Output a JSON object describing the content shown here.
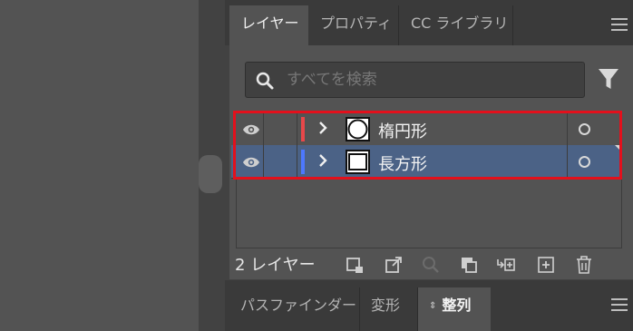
{
  "panel_tabs": [
    {
      "label": "レイヤー",
      "active": true
    },
    {
      "label": "プロパティ",
      "active": false
    },
    {
      "label": "CC ライブラリ",
      "active": false
    }
  ],
  "search": {
    "placeholder": "すべてを検索",
    "value": ""
  },
  "layers": [
    {
      "name": "楕円形",
      "color": "#e8484a",
      "thumbnail": "ellipse",
      "selected": false
    },
    {
      "name": "長方形",
      "color": "#4d78ff",
      "thumbnail": "rectangle",
      "selected": true
    }
  ],
  "footer": {
    "layer_count": "2 レイヤー",
    "icons": [
      "collect-for-export-icon",
      "export-icon",
      "locate-object-icon",
      "clipping-mask-icon",
      "new-sublayer-icon",
      "new-layer-icon",
      "trash-icon"
    ]
  },
  "bottom_tabs": [
    {
      "label": "パスファインダー",
      "active": false
    },
    {
      "label": "変形",
      "active": false
    },
    {
      "label": "整列",
      "active": true,
      "updown": "⇕"
    }
  ],
  "colors": {
    "selected_row": "#4b6286",
    "highlight_box": "#e3101c"
  }
}
